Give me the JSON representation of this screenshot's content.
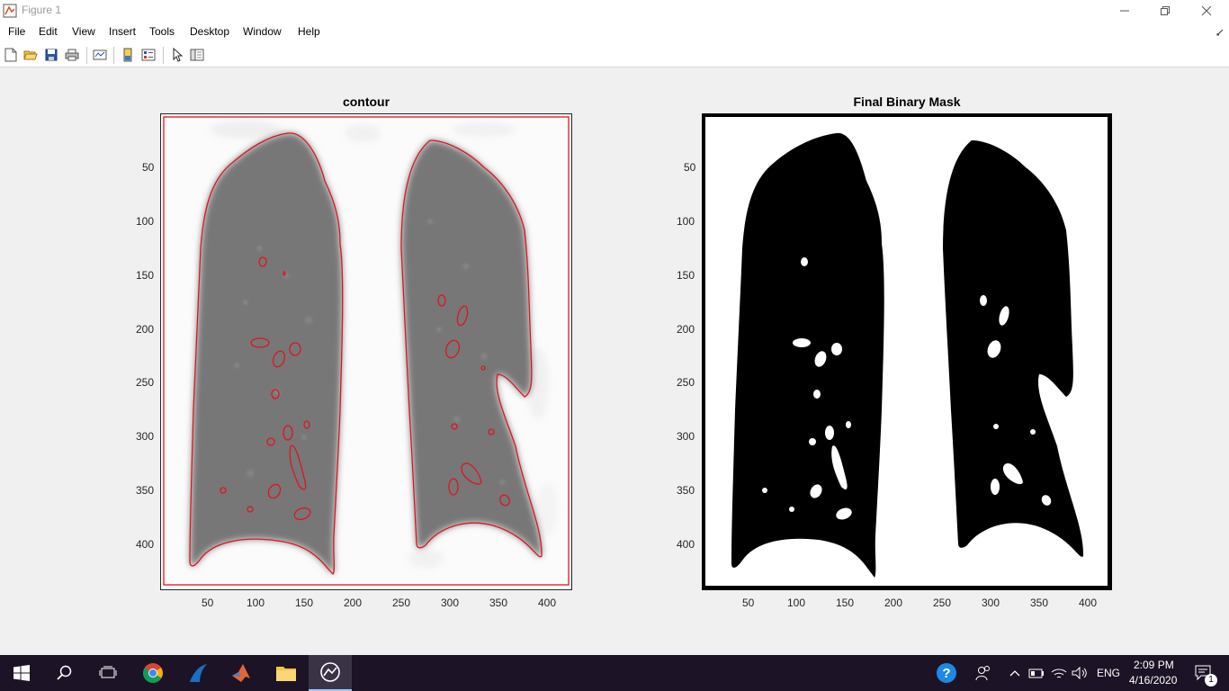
{
  "window": {
    "title": "Figure 1"
  },
  "menu": [
    "File",
    "Edit",
    "View",
    "Insert",
    "Tools",
    "Desktop",
    "Window",
    "Help"
  ],
  "toolbar": [
    "new-figure",
    "open-file",
    "save",
    "print",
    "link-plot",
    "insert-colorbar",
    "insert-legend",
    "edit-plot",
    "property-inspector"
  ],
  "axes_left": {
    "title": "contour",
    "xticks": [
      "50",
      "100",
      "150",
      "200",
      "250",
      "300",
      "350",
      "400"
    ],
    "yticks": [
      "50",
      "100",
      "150",
      "200",
      "250",
      "300",
      "350",
      "400"
    ],
    "contour_color": "#e0141e"
  },
  "axes_right": {
    "title": "Final Binary Mask",
    "xticks": [
      "50",
      "100",
      "150",
      "200",
      "250",
      "300",
      "350",
      "400"
    ],
    "yticks": [
      "50",
      "100",
      "150",
      "200",
      "250",
      "300",
      "350",
      "400"
    ]
  },
  "taskbar": {
    "apps": [
      "windows-start",
      "search",
      "task-view",
      "chrome",
      "wireshark",
      "matlab",
      "file-explorer",
      "figure-window"
    ],
    "lang": "ENG",
    "time": "2:09 PM",
    "date": "4/16/2020",
    "notif_count": "1"
  }
}
